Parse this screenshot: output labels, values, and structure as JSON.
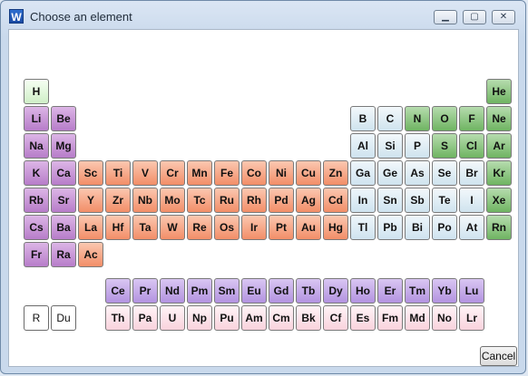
{
  "window": {
    "title": "Choose an element",
    "app_icon_letter": "W",
    "minimize_glyph": "▁",
    "maximize_glyph": "▢",
    "close_glyph": "✕"
  },
  "table": {
    "rows": [
      [
        {
          "c": 0,
          "s": "H",
          "t": "h"
        },
        {
          "c": 17,
          "s": "He",
          "t": "noble"
        }
      ],
      [
        {
          "c": 0,
          "s": "Li",
          "t": "alkali"
        },
        {
          "c": 1,
          "s": "Be",
          "t": "alkali"
        },
        {
          "c": 12,
          "s": "B",
          "t": "semimetal"
        },
        {
          "c": 13,
          "s": "C",
          "t": "semimetal"
        },
        {
          "c": 14,
          "s": "N",
          "t": "nonmetal"
        },
        {
          "c": 15,
          "s": "O",
          "t": "nonmetal"
        },
        {
          "c": 16,
          "s": "F",
          "t": "nonmetal"
        },
        {
          "c": 17,
          "s": "Ne",
          "t": "noble"
        }
      ],
      [
        {
          "c": 0,
          "s": "Na",
          "t": "alkali"
        },
        {
          "c": 1,
          "s": "Mg",
          "t": "alkali"
        },
        {
          "c": 12,
          "s": "Al",
          "t": "metal"
        },
        {
          "c": 13,
          "s": "Si",
          "t": "semimetal"
        },
        {
          "c": 14,
          "s": "P",
          "t": "semimetal"
        },
        {
          "c": 15,
          "s": "S",
          "t": "nonmetal"
        },
        {
          "c": 16,
          "s": "Cl",
          "t": "nonmetal"
        },
        {
          "c": 17,
          "s": "Ar",
          "t": "noble"
        }
      ],
      [
        {
          "c": 0,
          "s": "K",
          "t": "alkali"
        },
        {
          "c": 1,
          "s": "Ca",
          "t": "alkali"
        },
        {
          "c": 2,
          "s": "Sc",
          "t": "trans"
        },
        {
          "c": 3,
          "s": "Ti",
          "t": "trans"
        },
        {
          "c": 4,
          "s": "V",
          "t": "trans"
        },
        {
          "c": 5,
          "s": "Cr",
          "t": "trans"
        },
        {
          "c": 6,
          "s": "Mn",
          "t": "trans"
        },
        {
          "c": 7,
          "s": "Fe",
          "t": "trans"
        },
        {
          "c": 8,
          "s": "Co",
          "t": "trans"
        },
        {
          "c": 9,
          "s": "Ni",
          "t": "trans"
        },
        {
          "c": 10,
          "s": "Cu",
          "t": "trans"
        },
        {
          "c": 11,
          "s": "Zn",
          "t": "trans"
        },
        {
          "c": 12,
          "s": "Ga",
          "t": "metal"
        },
        {
          "c": 13,
          "s": "Ge",
          "t": "semimetal"
        },
        {
          "c": 14,
          "s": "As",
          "t": "semimetal"
        },
        {
          "c": 15,
          "s": "Se",
          "t": "semimetal"
        },
        {
          "c": 16,
          "s": "Br",
          "t": "semimetal"
        },
        {
          "c": 17,
          "s": "Kr",
          "t": "noble"
        }
      ],
      [
        {
          "c": 0,
          "s": "Rb",
          "t": "alkali"
        },
        {
          "c": 1,
          "s": "Sr",
          "t": "alkali"
        },
        {
          "c": 2,
          "s": "Y",
          "t": "trans"
        },
        {
          "c": 3,
          "s": "Zr",
          "t": "trans"
        },
        {
          "c": 4,
          "s": "Nb",
          "t": "trans"
        },
        {
          "c": 5,
          "s": "Mo",
          "t": "trans"
        },
        {
          "c": 6,
          "s": "Tc",
          "t": "trans"
        },
        {
          "c": 7,
          "s": "Ru",
          "t": "trans"
        },
        {
          "c": 8,
          "s": "Rh",
          "t": "trans"
        },
        {
          "c": 9,
          "s": "Pd",
          "t": "trans"
        },
        {
          "c": 10,
          "s": "Ag",
          "t": "trans"
        },
        {
          "c": 11,
          "s": "Cd",
          "t": "trans"
        },
        {
          "c": 12,
          "s": "In",
          "t": "metal"
        },
        {
          "c": 13,
          "s": "Sn",
          "t": "metal"
        },
        {
          "c": 14,
          "s": "Sb",
          "t": "semimetal"
        },
        {
          "c": 15,
          "s": "Te",
          "t": "semimetal"
        },
        {
          "c": 16,
          "s": "I",
          "t": "semimetal"
        },
        {
          "c": 17,
          "s": "Xe",
          "t": "noble"
        }
      ],
      [
        {
          "c": 0,
          "s": "Cs",
          "t": "alkali"
        },
        {
          "c": 1,
          "s": "Ba",
          "t": "alkali"
        },
        {
          "c": 2,
          "s": "La",
          "t": "trans"
        },
        {
          "c": 3,
          "s": "Hf",
          "t": "trans"
        },
        {
          "c": 4,
          "s": "Ta",
          "t": "trans"
        },
        {
          "c": 5,
          "s": "W",
          "t": "trans"
        },
        {
          "c": 6,
          "s": "Re",
          "t": "trans"
        },
        {
          "c": 7,
          "s": "Os",
          "t": "trans"
        },
        {
          "c": 8,
          "s": "Ir",
          "t": "trans"
        },
        {
          "c": 9,
          "s": "Pt",
          "t": "trans"
        },
        {
          "c": 10,
          "s": "Au",
          "t": "trans"
        },
        {
          "c": 11,
          "s": "Hg",
          "t": "trans"
        },
        {
          "c": 12,
          "s": "Tl",
          "t": "metal"
        },
        {
          "c": 13,
          "s": "Pb",
          "t": "metal"
        },
        {
          "c": 14,
          "s": "Bi",
          "t": "metal"
        },
        {
          "c": 15,
          "s": "Po",
          "t": "metal"
        },
        {
          "c": 16,
          "s": "At",
          "t": "semimetal"
        },
        {
          "c": 17,
          "s": "Rn",
          "t": "noble"
        }
      ],
      [
        {
          "c": 0,
          "s": "Fr",
          "t": "alkali"
        },
        {
          "c": 1,
          "s": "Ra",
          "t": "alkali"
        },
        {
          "c": 2,
          "s": "Ac",
          "t": "trans"
        }
      ],
      [
        {
          "c": 3,
          "s": "Ce",
          "t": "lanth"
        },
        {
          "c": 4,
          "s": "Pr",
          "t": "lanth"
        },
        {
          "c": 5,
          "s": "Nd",
          "t": "lanth"
        },
        {
          "c": 6,
          "s": "Pm",
          "t": "lanth"
        },
        {
          "c": 7,
          "s": "Sm",
          "t": "lanth"
        },
        {
          "c": 8,
          "s": "Eu",
          "t": "lanth"
        },
        {
          "c": 9,
          "s": "Gd",
          "t": "lanth"
        },
        {
          "c": 10,
          "s": "Tb",
          "t": "lanth"
        },
        {
          "c": 11,
          "s": "Dy",
          "t": "lanth"
        },
        {
          "c": 12,
          "s": "Ho",
          "t": "lanth"
        },
        {
          "c": 13,
          "s": "Er",
          "t": "lanth"
        },
        {
          "c": 14,
          "s": "Tm",
          "t": "lanth"
        },
        {
          "c": 15,
          "s": "Yb",
          "t": "lanth"
        },
        {
          "c": 16,
          "s": "Lu",
          "t": "lanth"
        }
      ],
      [
        {
          "c": 0,
          "s": "R",
          "t": "special"
        },
        {
          "c": 1,
          "s": "Du",
          "t": "special"
        },
        {
          "c": 3,
          "s": "Th",
          "t": "actin"
        },
        {
          "c": 4,
          "s": "Pa",
          "t": "actin"
        },
        {
          "c": 5,
          "s": "U",
          "t": "actin"
        },
        {
          "c": 6,
          "s": "Np",
          "t": "actin"
        },
        {
          "c": 7,
          "s": "Pu",
          "t": "actin"
        },
        {
          "c": 8,
          "s": "Am",
          "t": "actin"
        },
        {
          "c": 9,
          "s": "Cm",
          "t": "actin"
        },
        {
          "c": 10,
          "s": "Bk",
          "t": "actin"
        },
        {
          "c": 11,
          "s": "Cf",
          "t": "actin"
        },
        {
          "c": 12,
          "s": "Es",
          "t": "actin"
        },
        {
          "c": 13,
          "s": "Fm",
          "t": "actin"
        },
        {
          "c": 14,
          "s": "Md",
          "t": "actin"
        },
        {
          "c": 15,
          "s": "No",
          "t": "actin"
        },
        {
          "c": 16,
          "s": "Lr",
          "t": "actin"
        }
      ]
    ]
  },
  "footer": {
    "cancel_label": "Cancel"
  }
}
